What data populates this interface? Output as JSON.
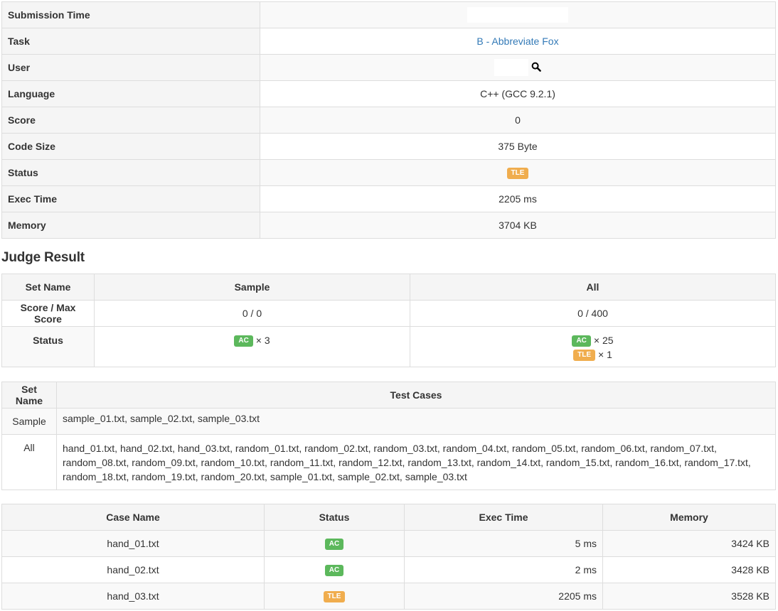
{
  "info": {
    "rows": {
      "submission_time": {
        "label": "Submission Time"
      },
      "task": {
        "label": "Task",
        "value": "B - Abbreviate Fox"
      },
      "user": {
        "label": "User"
      },
      "language": {
        "label": "Language",
        "value": "C++ (GCC 9.2.1)"
      },
      "score": {
        "label": "Score",
        "value": "0"
      },
      "code_size": {
        "label": "Code Size",
        "value": "375 Byte"
      },
      "status": {
        "label": "Status",
        "value": "TLE"
      },
      "exec_time": {
        "label": "Exec Time",
        "value": "2205 ms"
      },
      "memory": {
        "label": "Memory",
        "value": "3704 KB"
      }
    }
  },
  "judge_result": {
    "title": "Judge Result",
    "headers": {
      "set_name": "Set Name",
      "sample": "Sample",
      "all": "All"
    },
    "score_label": "Score / Max Score",
    "sample_score": "0 / 0",
    "all_score": "0 / 400",
    "status_label": "Status",
    "sample_status": {
      "label": "AC",
      "count": "× 3"
    },
    "all_status": [
      {
        "label": "AC",
        "count": "× 25"
      },
      {
        "label": "TLE",
        "count": "× 1"
      }
    ]
  },
  "set_table": {
    "headers": {
      "set_name": "Set Name",
      "test_cases": "Test Cases"
    },
    "rows": [
      {
        "set": "Sample",
        "cases": "sample_01.txt, sample_02.txt, sample_03.txt"
      },
      {
        "set": "All",
        "cases": "hand_01.txt, hand_02.txt, hand_03.txt, random_01.txt, random_02.txt, random_03.txt, random_04.txt, random_05.txt, random_06.txt, random_07.txt, random_08.txt, random_09.txt, random_10.txt, random_11.txt, random_12.txt, random_13.txt, random_14.txt, random_15.txt, random_16.txt, random_17.txt, random_18.txt, random_19.txt, random_20.txt, sample_01.txt, sample_02.txt, sample_03.txt"
      }
    ]
  },
  "case_table": {
    "headers": {
      "case_name": "Case Name",
      "status": "Status",
      "exec_time": "Exec Time",
      "memory": "Memory"
    },
    "rows": [
      {
        "name": "hand_01.txt",
        "status": "AC",
        "time": "5 ms",
        "memory": "3424 KB"
      },
      {
        "name": "hand_02.txt",
        "status": "AC",
        "time": "2 ms",
        "memory": "3428 KB"
      },
      {
        "name": "hand_03.txt",
        "status": "TLE",
        "time": "2205 ms",
        "memory": "3528 KB"
      }
    ]
  },
  "colors": {
    "ac": "#5cb85c",
    "tle": "#f0ad4e",
    "link": "#337ab7",
    "header_bg": "#f5f5f5",
    "stripe_bg": "#f9f9f9",
    "border": "#dddddd"
  },
  "icons": {
    "user_search": "search-icon"
  }
}
